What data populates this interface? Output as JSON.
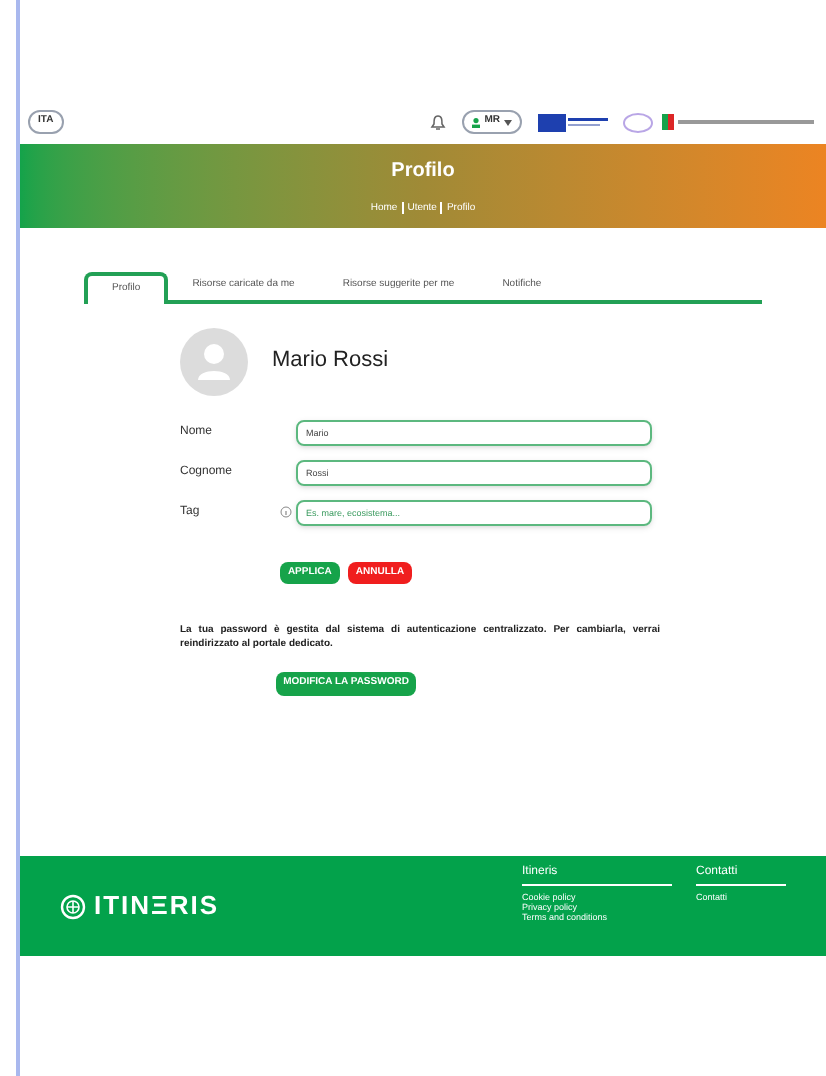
{
  "top_bar": {
    "language": "ITA",
    "user": "MR"
  },
  "header": {
    "title": "Profilo",
    "breadcrumb": [
      "Home",
      "Utente",
      "Profilo"
    ]
  },
  "tabs": [
    {
      "label": "Profilo",
      "selected": true
    },
    {
      "label": "Risorse caricate da me",
      "selected": false
    },
    {
      "label": "Risorse suggerite per me",
      "selected": false
    },
    {
      "label": "Notifiche",
      "selected": false
    }
  ],
  "profile": {
    "name": "Mario Rossi"
  },
  "form": {
    "fields": [
      {
        "label": "Nome",
        "value": "Mario"
      },
      {
        "label": "Cognome",
        "value": "Rossi"
      },
      {
        "label": "Tag",
        "placeholder": "Es. mare, ecosistema...",
        "info": true
      }
    ],
    "buttons": [
      {
        "label": "APPLICA",
        "kind": "primary"
      },
      {
        "label": "ANNULLA",
        "kind": "danger"
      }
    ]
  },
  "password": {
    "text": "La tua password è gestita dal sistema di autenticazione centralizzato. Per cambiarla, verrai reindirizzato al portale dedicato.",
    "button": "MODIFICA LA PASSWORD"
  },
  "footer": {
    "logo": "ITINΞRIS",
    "sections": [
      {
        "title": "Itineris",
        "links": [
          "Cookie policy",
          "Privacy policy",
          "Terms and conditions"
        ]
      },
      {
        "title": "Contatti",
        "links": [
          "Contatti"
        ]
      }
    ]
  }
}
